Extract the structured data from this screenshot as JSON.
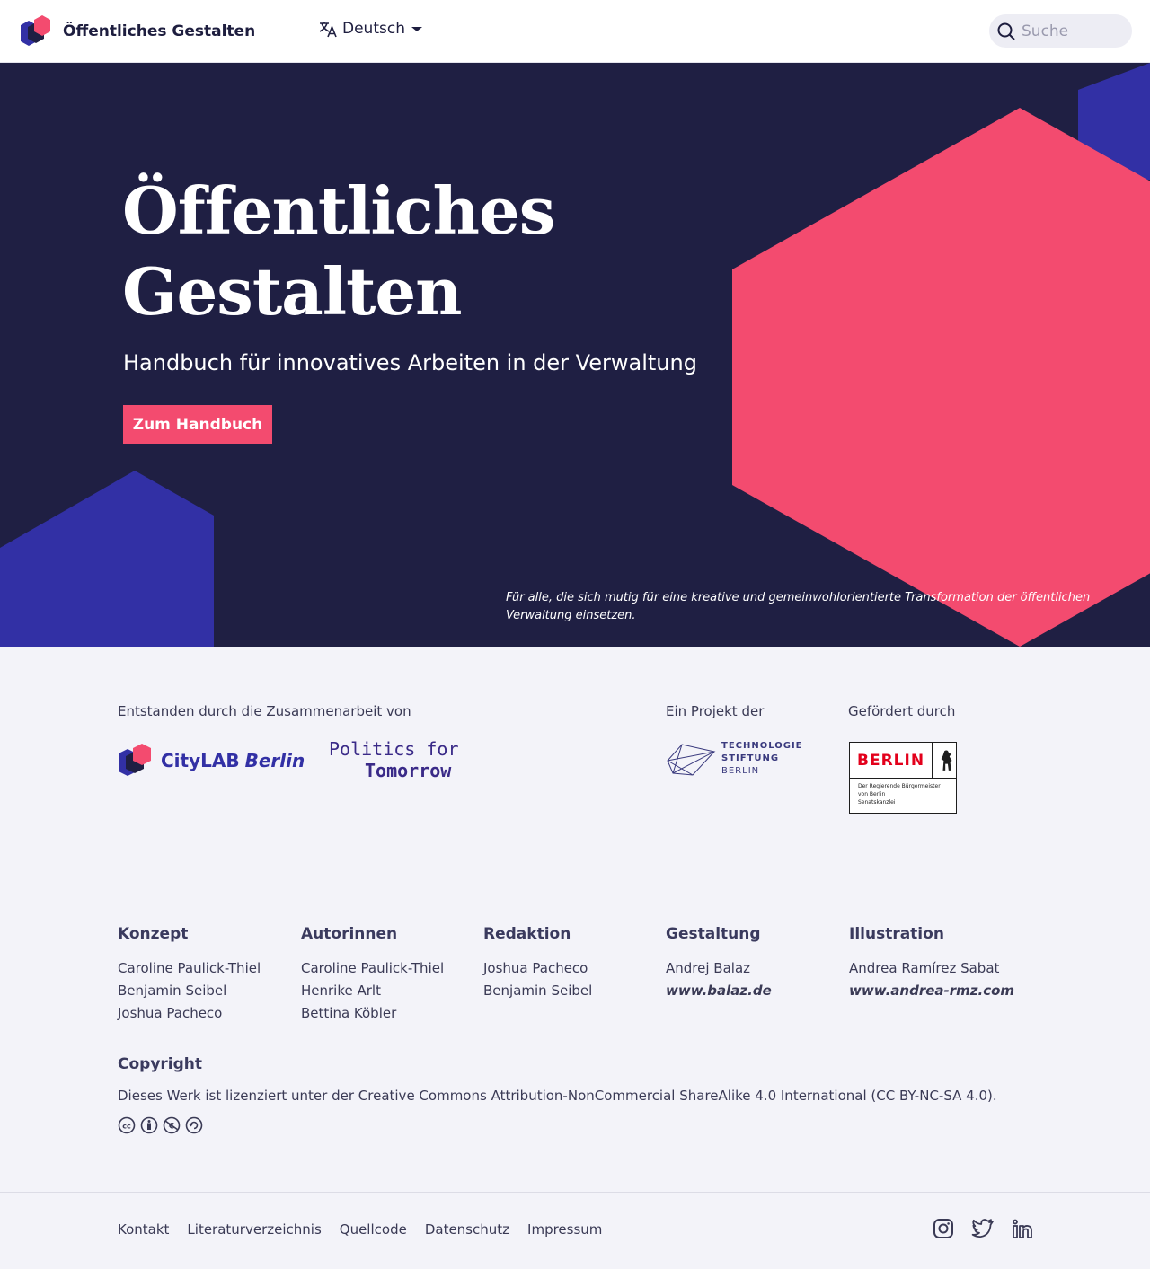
{
  "header": {
    "brand_title": "Öffentliches Gestalten",
    "language_label": "Deutsch",
    "search_placeholder": "Suche"
  },
  "hero": {
    "title_line1": "Öffentliches",
    "title_line2": "Gestalten",
    "subtitle": "Handbuch für innovatives Arbeiten in der Verwaltung",
    "cta_label": "Zum Handbuch",
    "tagline": "Für alle, die sich mutig für eine kreative und gemeinwohlorientierte Transformation der öffentlichen Verwaltung einsetzen."
  },
  "partners": {
    "collab_label": "Entstanden durch die Zusammenarbeit von",
    "project_label": "Ein Projekt der",
    "funded_label": "Gefördert durch",
    "citylab": {
      "word1": "CityLAB",
      "word2": "Berlin"
    },
    "pft": {
      "line1": "Politics for",
      "line2": "Tomorrow"
    },
    "tsb": {
      "line1": "TECHNOLOGIE",
      "line2": "STIFTUNG",
      "line3": "BERLIN"
    },
    "berlin": {
      "word": "BERLIN",
      "sub1": "Der Regierende Bürgermeister",
      "sub2": "von Berlin",
      "sub3": "Senatskanzlei"
    }
  },
  "credits": {
    "columns": [
      {
        "heading": "Konzept",
        "lines": [
          "Caroline Paulick-Thiel",
          "Benjamin Seibel",
          "Joshua Pacheco"
        ]
      },
      {
        "heading": "Autorinnen",
        "lines": [
          "Caroline Paulick-Thiel",
          "Henrike Arlt",
          "Bettina Köbler"
        ]
      },
      {
        "heading": "Redaktion",
        "lines": [
          "Joshua Pacheco",
          "Benjamin Seibel"
        ]
      },
      {
        "heading": "Gestaltung",
        "lines": [
          "Andrej Balaz"
        ],
        "link": "www.balaz.de"
      },
      {
        "heading": "Illustration",
        "lines": [
          "Andrea Ramírez Sabat"
        ],
        "link": "www.andrea-rmz.com"
      }
    ]
  },
  "copyright": {
    "heading": "Copyright",
    "text": "Dieses Werk ist lizenziert unter der Creative Commons Attribution-NonCommercial ShareAlike 4.0 International (CC BY-NC-SA 4.0)."
  },
  "footer": {
    "links": [
      "Kontakt",
      "Literaturverzeichnis",
      "Quellcode",
      "Datenschutz",
      "Impressum"
    ],
    "social": [
      "instagram-icon",
      "twitter-icon",
      "linkedin-icon"
    ]
  },
  "colors": {
    "navy": "#1f1f43",
    "pink": "#f34b6f",
    "indigo": "#3230a5",
    "light_bg": "#f3f3f9"
  }
}
